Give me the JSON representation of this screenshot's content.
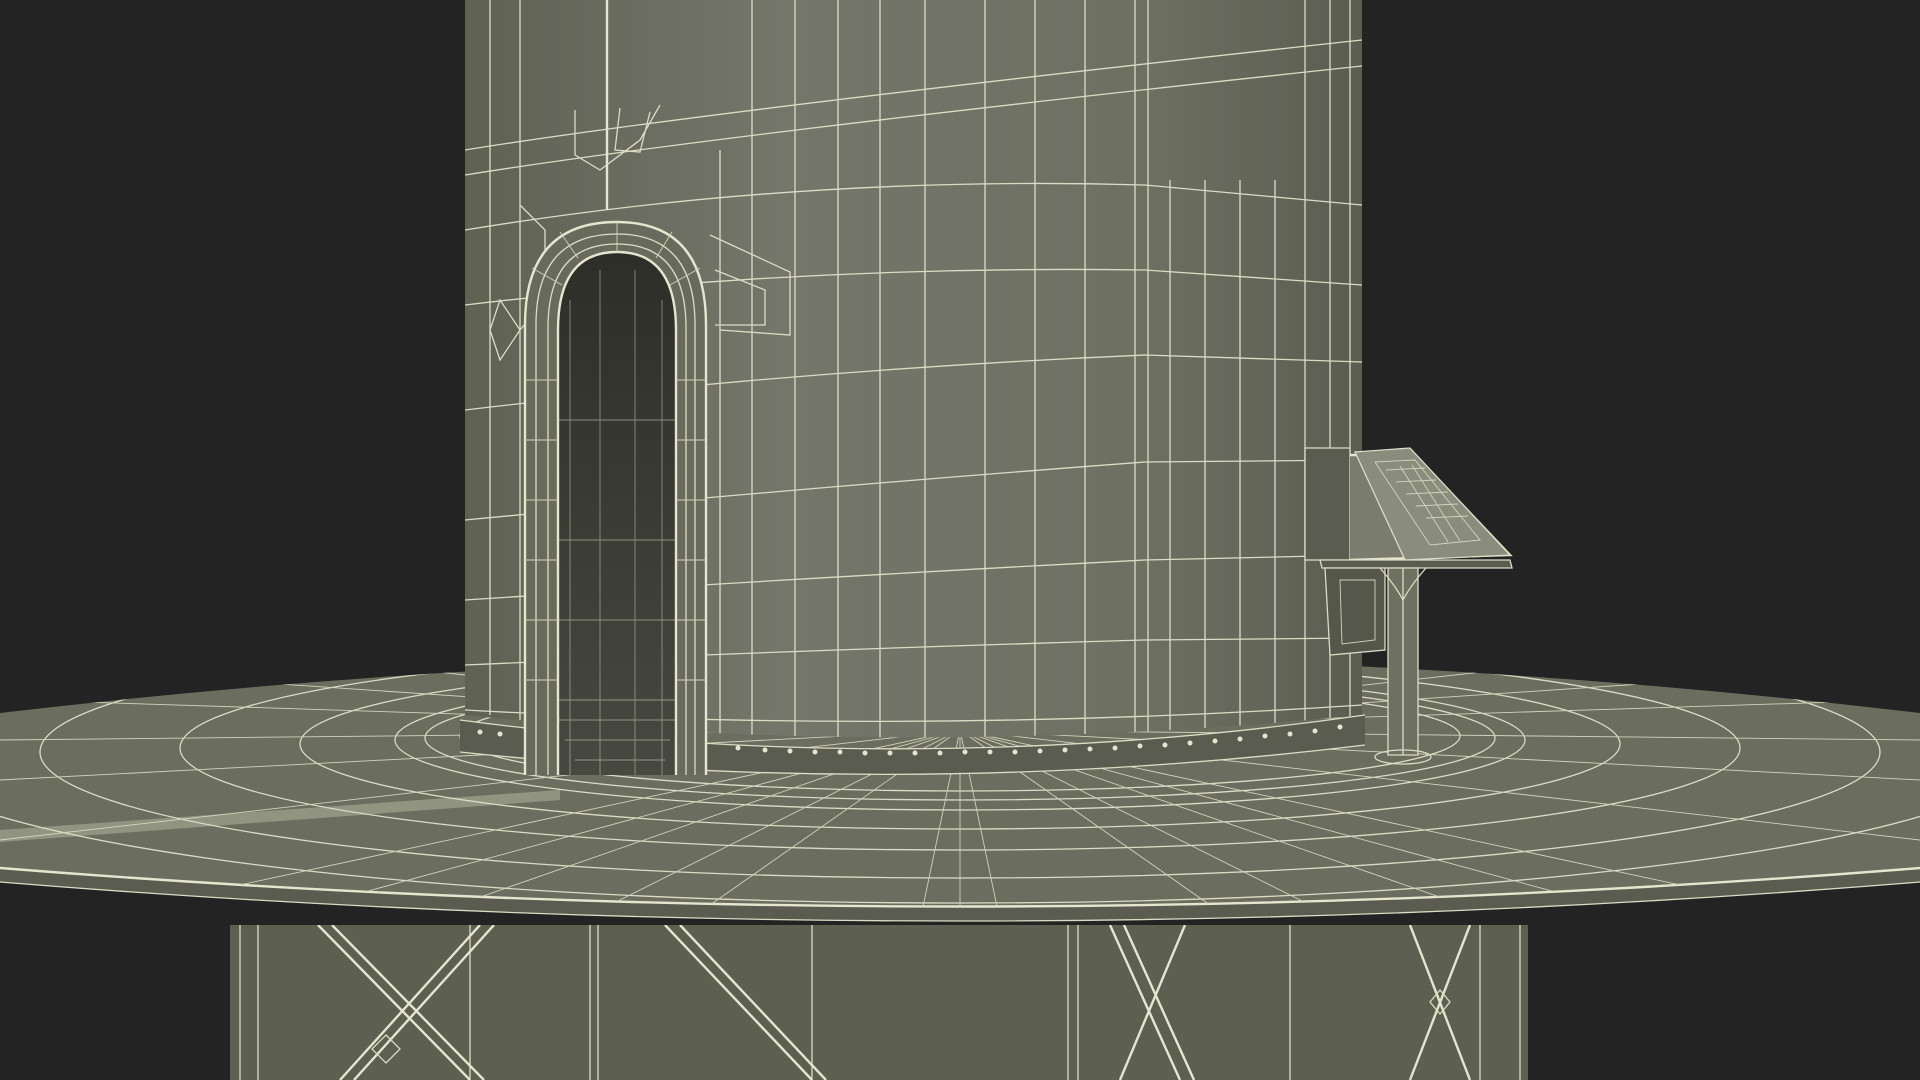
{
  "scene": {
    "background": "#222322",
    "mesh_fill": "#6d6f60",
    "mesh_shade": "#5d5f51",
    "mesh_dark": "#3a3b33",
    "wire_color": "#dcdcc6"
  }
}
